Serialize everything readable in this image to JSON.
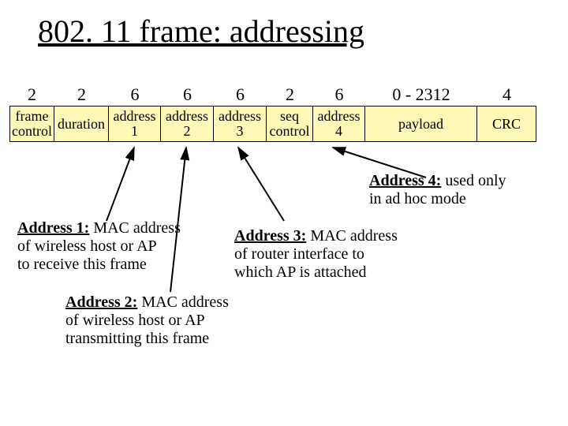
{
  "title": "802. 11 frame: addressing",
  "sizes": [
    "2",
    "2",
    "6",
    "6",
    "6",
    "2",
    "6",
    "0 - 2312",
    "4"
  ],
  "fields": [
    "frame\ncontrol",
    "duration",
    "address\n1",
    "address\n2",
    "address\n3",
    "seq\ncontrol",
    "address\n4",
    "payload",
    "CRC"
  ],
  "notes": {
    "a1_label": "Address 1:",
    "a1_text": " MAC address\nof wireless host or AP\nto receive this frame",
    "a2_label": "Address 2:",
    "a2_text": " MAC address\nof wireless host or AP\ntransmitting this frame",
    "a3_label": "Address 3:",
    "a3_text": " MAC address\nof router interface to\nwhich AP is attached",
    "a4_label": "Address 4:",
    "a4_text": " used only\nin ad hoc mode"
  }
}
